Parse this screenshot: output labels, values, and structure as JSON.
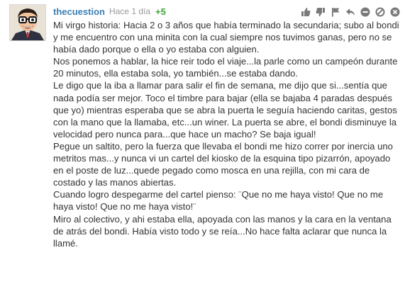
{
  "comment": {
    "username": "thecuestion",
    "time": "Hace 1 día",
    "score": "+5",
    "actions": [
      {
        "name": "thumbs-up-icon"
      },
      {
        "name": "thumbs-down-icon"
      },
      {
        "name": "flag-icon"
      },
      {
        "name": "reply-icon"
      },
      {
        "name": "minus-circle-icon"
      },
      {
        "name": "block-icon"
      },
      {
        "name": "close-circle-icon"
      }
    ],
    "paragraphs": [
      "Mi virgo historia: Hacia 2 o 3 años que había terminado la secundaria; subo al bondi y me encuentro con una minita con la cual siempre nos tuvimos ganas, pero no se había dado porque o ella o yo estaba con alguien.",
      "Nos ponemos a hablar, la hice reir todo el viaje...la parle como un campeón durante 20 minutos, ella estaba sola, yo también...se estaba dando.",
      "Le digo que la iba a llamar para salir el fin de semana, me dijo que si...sentía que nada podía ser mejor. Toco el timbre para bajar (ella se bajaba 4 paradas después que yo) mientras esperaba que se abra la puerta le seguía haciendo caritas, gestos con la mano que la llamaba, etc...un winer. La puerta se abre, el bondi disminuye la velocidad pero nunca para...que hace un macho? Se baja igual!",
      "Pegue un saltito, pero la fuerza que llevaba el bondi me hizo correr por inercia uno metritos mas...y nunca vi un cartel del kiosko de la esquina tipo pizarrón, apoyado en el poste de luz...quede pegado como mosca en una rejilla, con mi cara de costado y las manos abiertas.",
      "Cuando logro despegarme del cartel pienso: ¨Que no me haya visto! Que no me haya visto! Que no me haya visto!¨",
      "Miro al colectivo, y ahi estaba ella, apoyada con las manos y la cara en la ventana de atrás del bondi. Había visto todo y se reía...No hace falta aclarar que nunca la llamé."
    ],
    "colors": {
      "username": "#3b7fb6",
      "score": "#3fa33f",
      "icon": "#7a7a7a",
      "text": "#333333"
    }
  }
}
